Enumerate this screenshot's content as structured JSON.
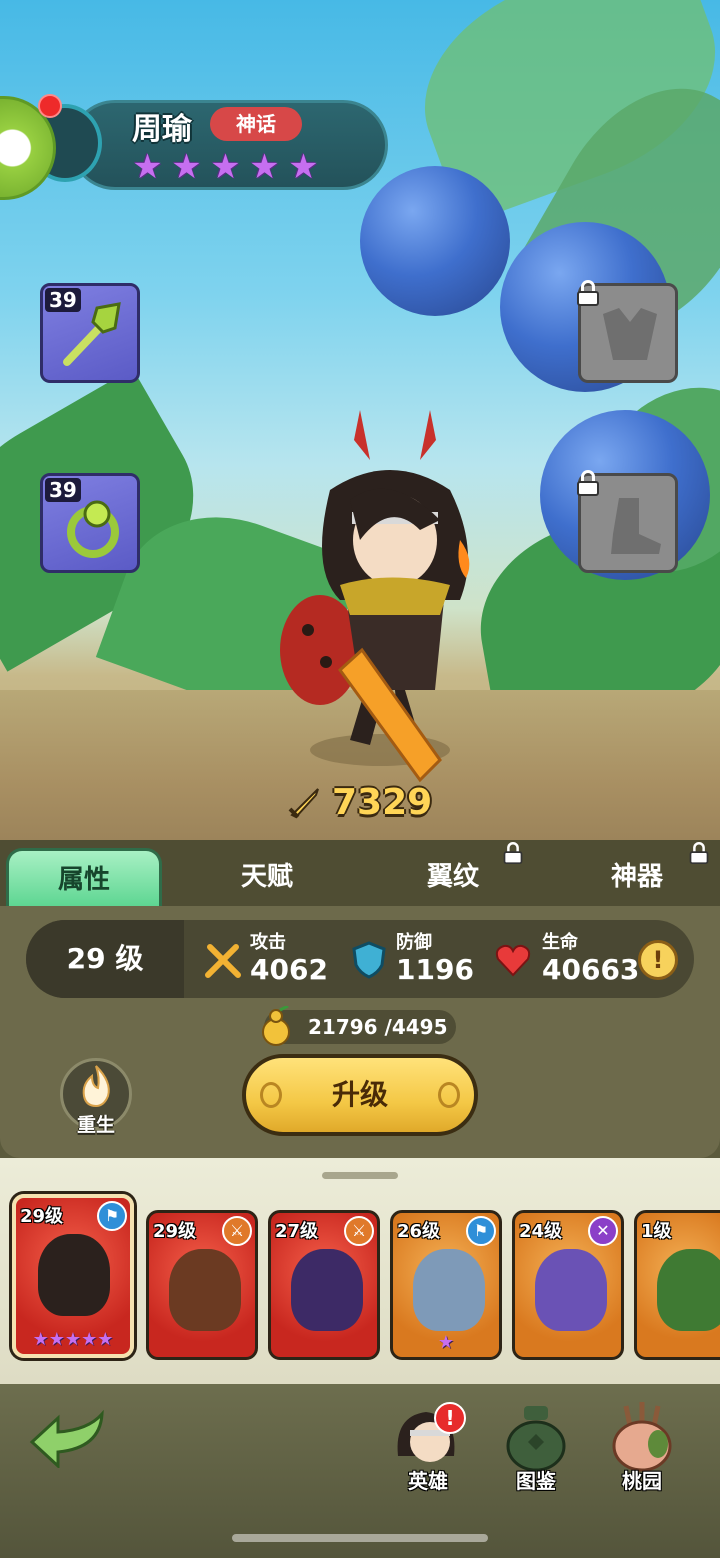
{
  "hero": {
    "name": "周瑜",
    "rarity": "神话",
    "stars": 5,
    "power": "7329"
  },
  "equipment": {
    "weapon_level": "39",
    "ring_level": "39"
  },
  "tabs": {
    "attributes": "属性",
    "talent": "天赋",
    "wing_pattern": "翼纹",
    "artifact": "神器"
  },
  "stats": {
    "level": "29 级",
    "attack_label": "攻击",
    "attack_value": "4062",
    "defense_label": "防御",
    "defense_value": "1196",
    "hp_label": "生命",
    "hp_value": "40663"
  },
  "upgrade": {
    "cost_text": "21796 /4495",
    "button_label": "升级",
    "rebirth_label": "重生"
  },
  "roster": [
    {
      "level": "29级",
      "stars": "★★★★★",
      "badge": "⚑",
      "badge_color": "#2f8fd8",
      "frame": "red"
    },
    {
      "level": "29级",
      "stars": "",
      "badge": "⚔",
      "badge_color": "#e0792a",
      "frame": "red"
    },
    {
      "level": "27级",
      "stars": "",
      "badge": "⚔",
      "badge_color": "#e0792a",
      "frame": "red"
    },
    {
      "level": "26级",
      "stars": "★",
      "badge": "⚑",
      "badge_color": "#2f8fd8",
      "frame": "orange"
    },
    {
      "level": "24级",
      "stars": "",
      "badge": "✕",
      "badge_color": "#8b3fc8",
      "frame": "orange"
    },
    {
      "level": "1级",
      "stars": "",
      "badge": "",
      "badge_color": "",
      "frame": "orange"
    }
  ],
  "nav": {
    "heroes": "英雄",
    "codex": "图鉴",
    "peach_garden": "桃园",
    "alert": "!"
  },
  "colors": {
    "rarity_badge": "#d74848",
    "power_text": "#ffd557",
    "upgrade_button": "#f4c846",
    "star_purple": "#c66ff0"
  }
}
